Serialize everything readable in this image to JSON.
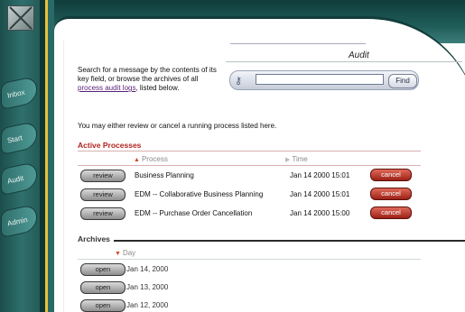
{
  "nav": {
    "items": [
      {
        "label": "Inbox"
      },
      {
        "label": "Start"
      },
      {
        "label": "Audit"
      },
      {
        "label": "Admin"
      }
    ]
  },
  "header": {
    "title": "Audit"
  },
  "search": {
    "intro_text": "Search for a message by the contents of its key field, or browse the archives of all",
    "link_text": "process audit logs",
    "intro_suffix": ", listed below.",
    "placeholder": "",
    "find_label": "Find"
  },
  "notice": "You may either review or cancel a running process listed here.",
  "active": {
    "title": "Active Processes",
    "col_process": "Process",
    "col_time": "Time",
    "review_label": "review",
    "cancel_label": "cancel",
    "rows": [
      {
        "process": "Business Planning",
        "time": "Jan 14 2000 15:01"
      },
      {
        "process": "EDM -- Collaborative Business Planning",
        "time": "Jan 14 2000 15:01"
      },
      {
        "process": "EDM -- Purchase Order Cancellation",
        "time": "Jan 14 2000 15:00"
      }
    ]
  },
  "archives": {
    "title": "Archives",
    "col_day": "Day",
    "open_label": "open",
    "rows": [
      {
        "day": "Jan 14, 2000"
      },
      {
        "day": "Jan 13, 2000"
      },
      {
        "day": "Jan 12, 2000"
      }
    ]
  }
}
